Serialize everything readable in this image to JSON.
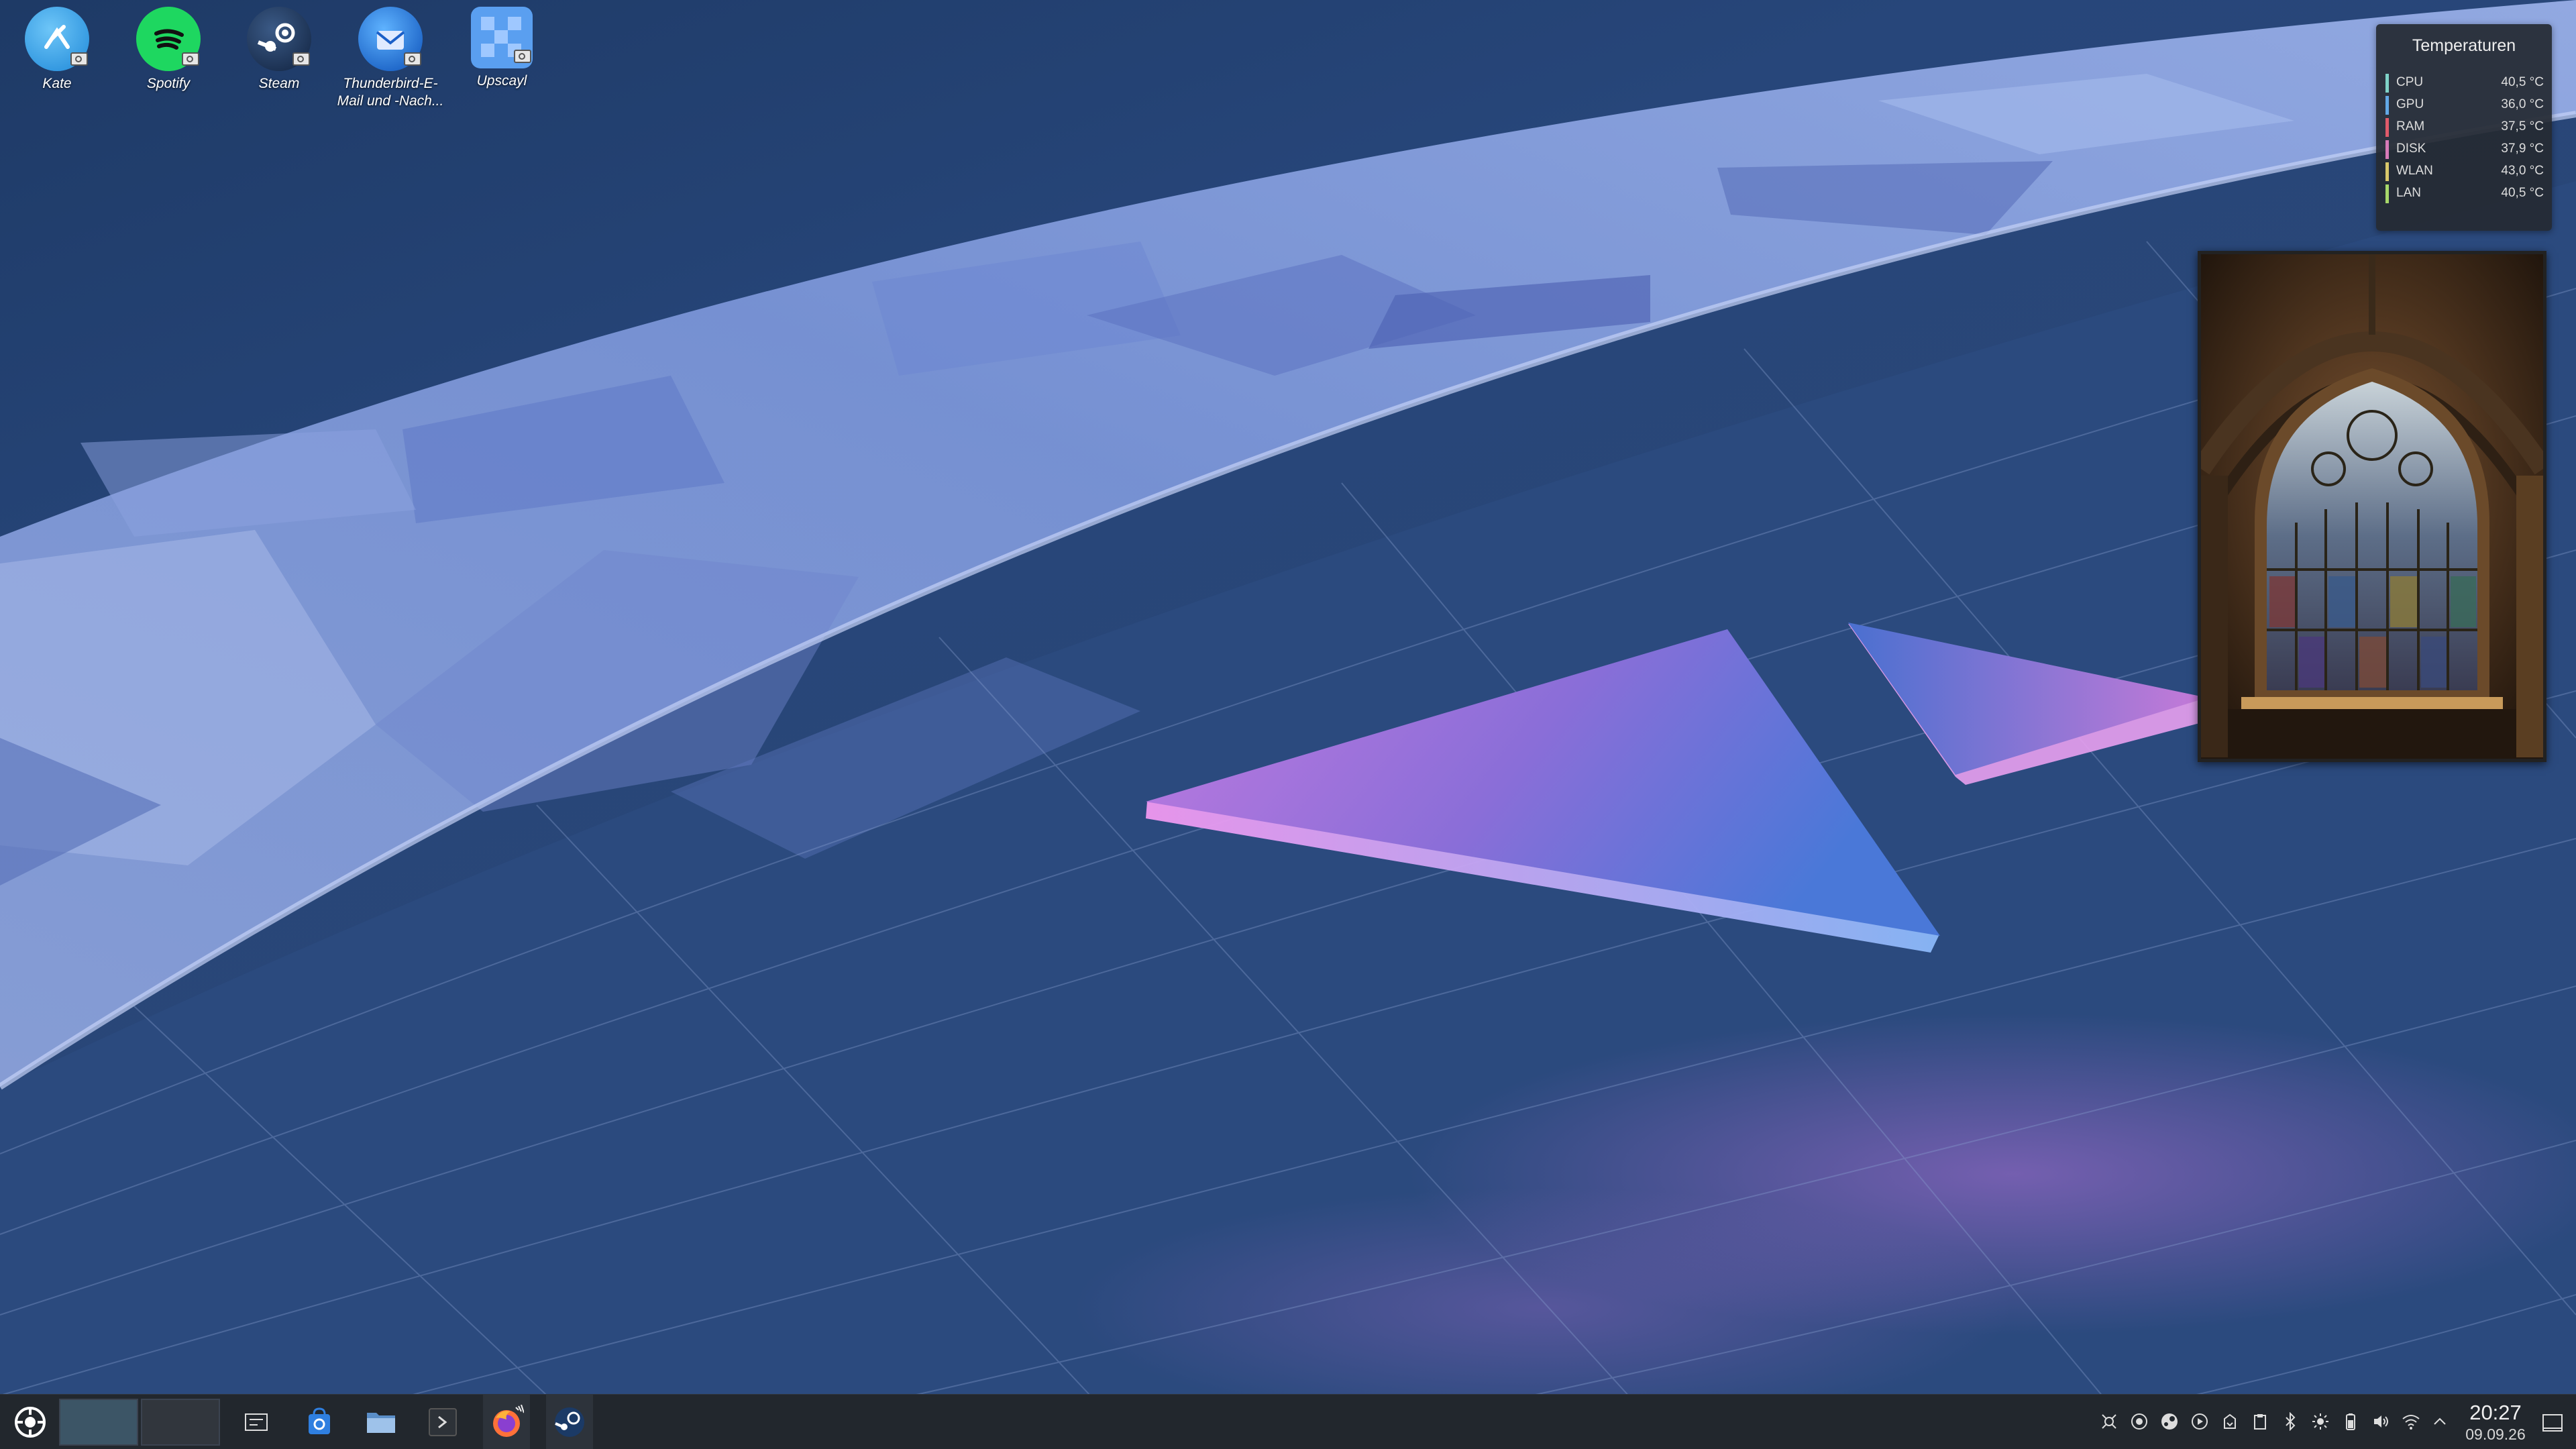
{
  "desktop": {
    "icons": [
      {
        "label": "Kate",
        "icon": "kate-icon"
      },
      {
        "label": "Spotify",
        "icon": "spotify-icon"
      },
      {
        "label": "Steam",
        "icon": "steam-icon"
      },
      {
        "label": "Thunderbird-E-Mail und -Nach...",
        "icon": "thunderbird-icon"
      },
      {
        "label": "Upscayl",
        "icon": "upscayl-icon"
      }
    ]
  },
  "temperature_widget": {
    "title": "Temperaturen",
    "rows": [
      {
        "name": "CPU",
        "value": "40,5 °C",
        "color": "#7fd3c8"
      },
      {
        "name": "GPU",
        "value": "36,0 °C",
        "color": "#62a8e6"
      },
      {
        "name": "RAM",
        "value": "37,5 °C",
        "color": "#e05a6a"
      },
      {
        "name": "DISK",
        "value": "37,9 °C",
        "color": "#d77ab8"
      },
      {
        "name": "WLAN",
        "value": "43,0 °C",
        "color": "#d8c76a"
      },
      {
        "name": "LAN",
        "value": "40,5 °C",
        "color": "#a8d86a"
      }
    ]
  },
  "photo_widget": {
    "subject": "stained-glass-window"
  },
  "taskbar": {
    "launcher_icon": "kde-application-launcher-icon",
    "pager": [
      "desktop-1",
      "desktop-2"
    ],
    "tasks": [
      {
        "icon": "overview-icon"
      },
      {
        "icon": "discover-store-icon"
      },
      {
        "icon": "file-manager-icon"
      },
      {
        "icon": "terminal-icon"
      },
      {
        "icon": "firefox-icon"
      },
      {
        "icon": "steam-icon"
      }
    ],
    "tray": [
      "kdeconnect-icon",
      "settings-icon",
      "steam-tray-icon",
      "media-player-icon",
      "updates-icon",
      "clipboard-icon",
      "bluetooth-icon",
      "brightness-icon",
      "battery-icon",
      "volume-icon",
      "wifi-icon",
      "expand-tray-icon"
    ],
    "clock": {
      "time": "20:27",
      "date": "09.09.26"
    },
    "show_desktop_icon": "show-desktop-icon"
  },
  "colors": {
    "taskbar_bg": "#22272d",
    "widget_bg": "#252a33",
    "wallpaper_accent_pink": "#e07ad9",
    "wallpaper_accent_blue": "#4a78d8"
  }
}
